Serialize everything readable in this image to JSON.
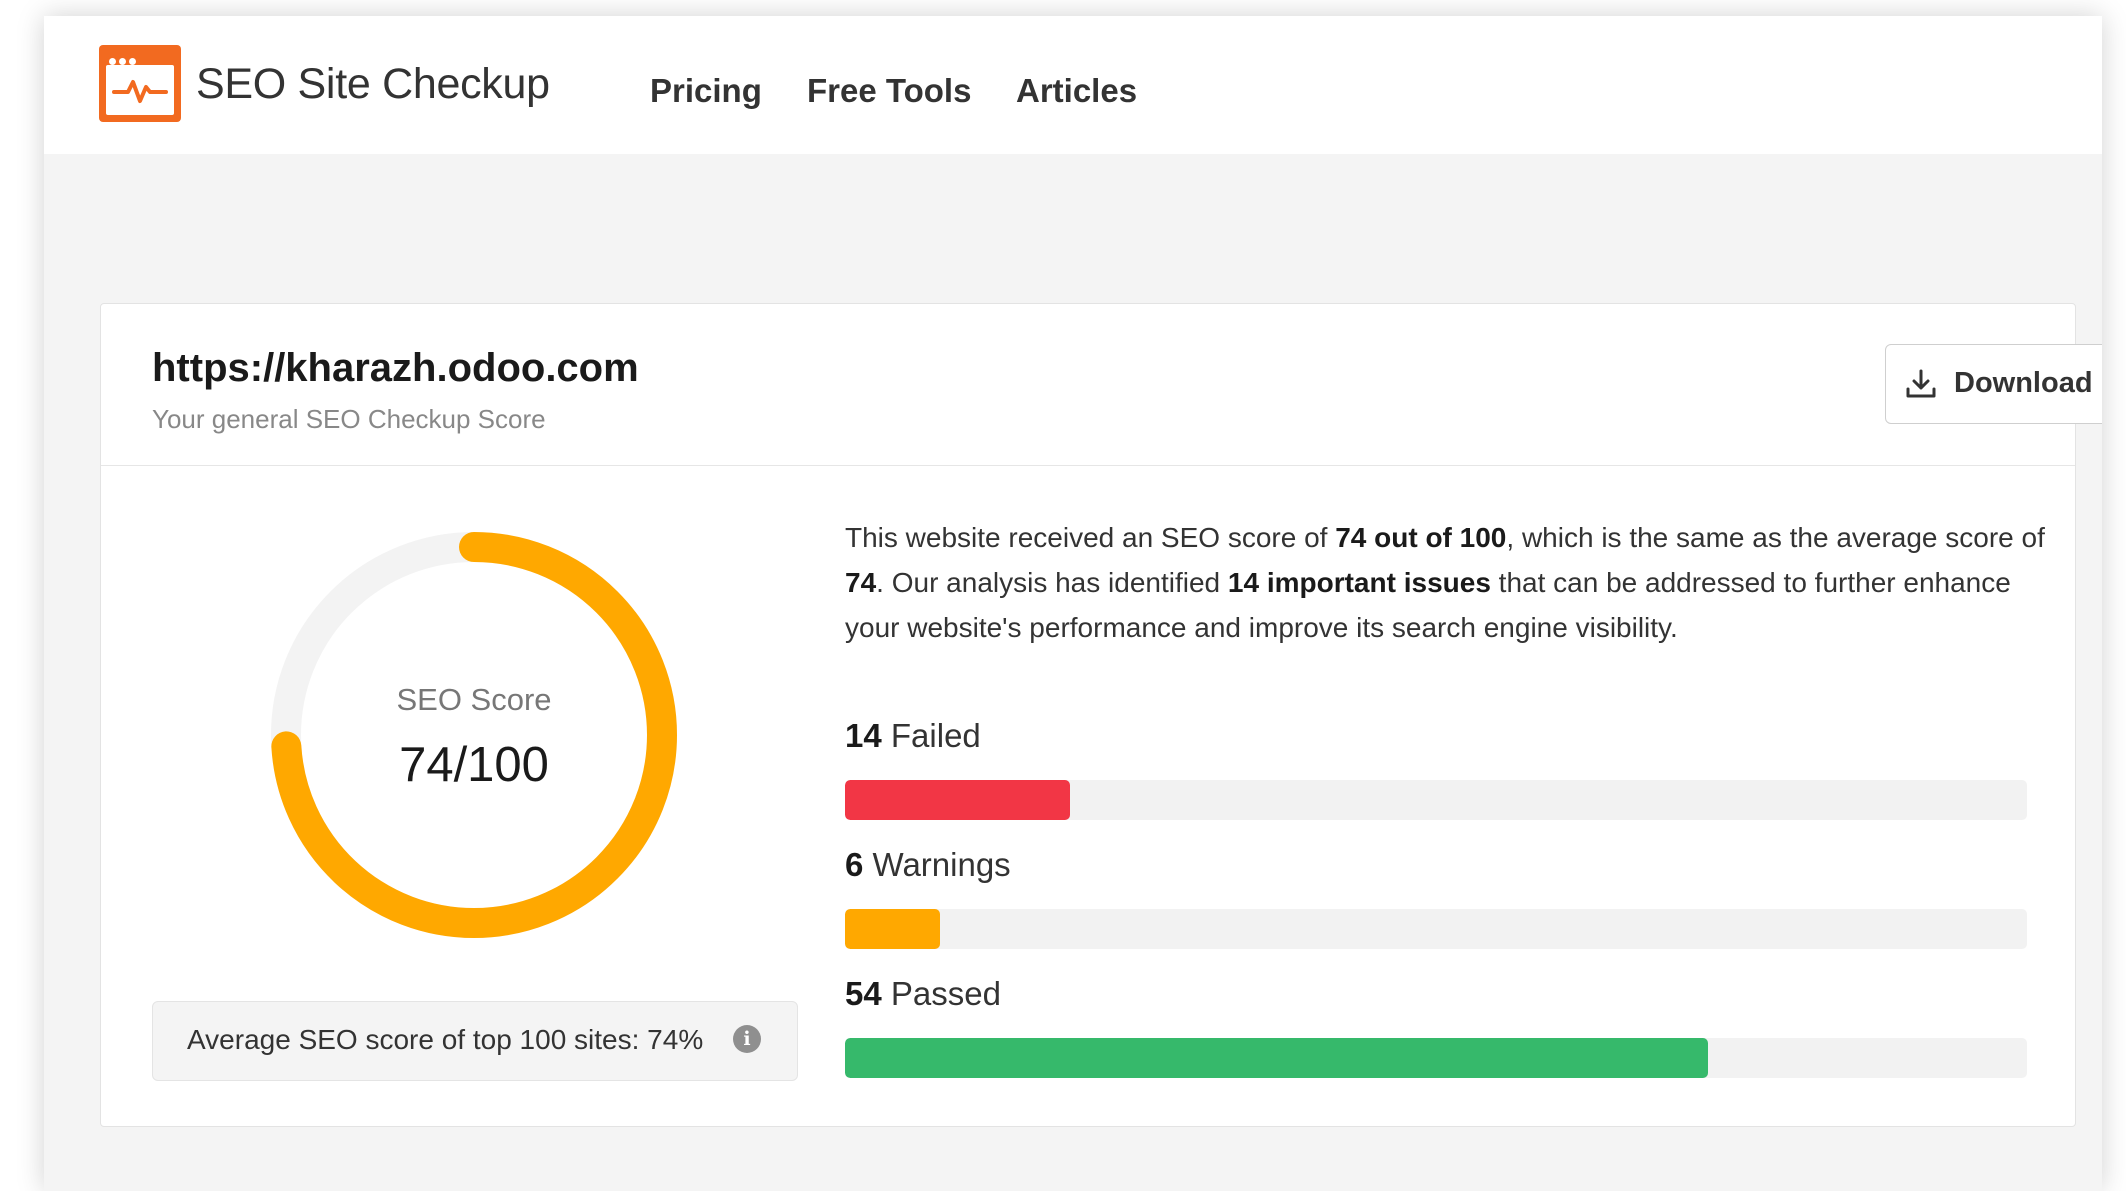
{
  "header": {
    "brand": "SEO Site Checkup",
    "nav": [
      "Pricing",
      "Free Tools",
      "Articles"
    ]
  },
  "report": {
    "url": "https://kharazh.odoo.com",
    "subtitle": "Your general SEO Checkup Score",
    "download_label": "Download PDF",
    "score_label": "SEO Score",
    "score_value": "74/100",
    "score_fraction": 0.74,
    "average_text": "Average SEO score of top 100 sites: 74%",
    "description": {
      "p1": "This website received an SEO score of ",
      "b1": "74 out of 100",
      "p2": ", which is the same as the average score of ",
      "b2": "74",
      "p3": ". Our analysis has identified ",
      "b3": "14 important issues",
      "p4": " that can be addressed to further enhance your website's performance and improve its search engine visibility."
    },
    "stats": {
      "failed": {
        "count": "14",
        "label": "Failed",
        "fraction": 0.19
      },
      "warnings": {
        "count": "6",
        "label": "Warnings",
        "fraction": 0.08
      },
      "passed": {
        "count": "54",
        "label": "Passed",
        "fraction": 0.73
      }
    }
  },
  "colors": {
    "accent_orange": "#f26a20",
    "score_amber": "#ffa800",
    "failed_red": "#f23645",
    "warning_amber": "#ffa800",
    "passed_green": "#36b96b"
  }
}
